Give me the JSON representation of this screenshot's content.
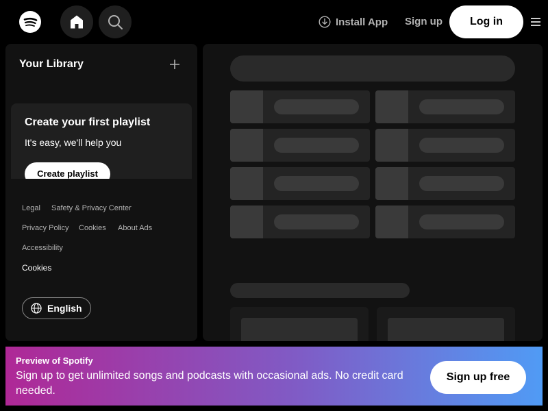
{
  "header": {
    "logo_icon": "spotify-logo-icon",
    "home_icon": "home-icon",
    "search_icon": "search-icon",
    "install_app_label": "Install App",
    "install_icon": "download-circle-icon",
    "sign_up_label": "Sign up",
    "log_in_label": "Log in",
    "menu_icon": "hamburger-menu-icon"
  },
  "library": {
    "title": "Your Library",
    "add_icon": "plus-icon",
    "promo": {
      "title": "Create your first playlist",
      "subtitle": "It's easy, we'll help you",
      "button_label": "Create playlist"
    },
    "footer_links": [
      "Legal",
      "Safety & Privacy Center",
      "Privacy Policy",
      "Cookies",
      "About Ads",
      "Accessibility"
    ],
    "cookies_link": "Cookies",
    "language_label": "English",
    "language_icon": "globe-icon"
  },
  "banner": {
    "title": "Preview of Spotify",
    "text": "Sign up to get unlimited songs and podcasts with occasional ads. No credit card needed.",
    "button_label": "Sign up free"
  },
  "colors": {
    "background": "#000000",
    "panel": "#121212",
    "text_muted": "#b3b3b3",
    "banner_gradient_start": "#af2896",
    "banner_gradient_end": "#509bf5"
  }
}
